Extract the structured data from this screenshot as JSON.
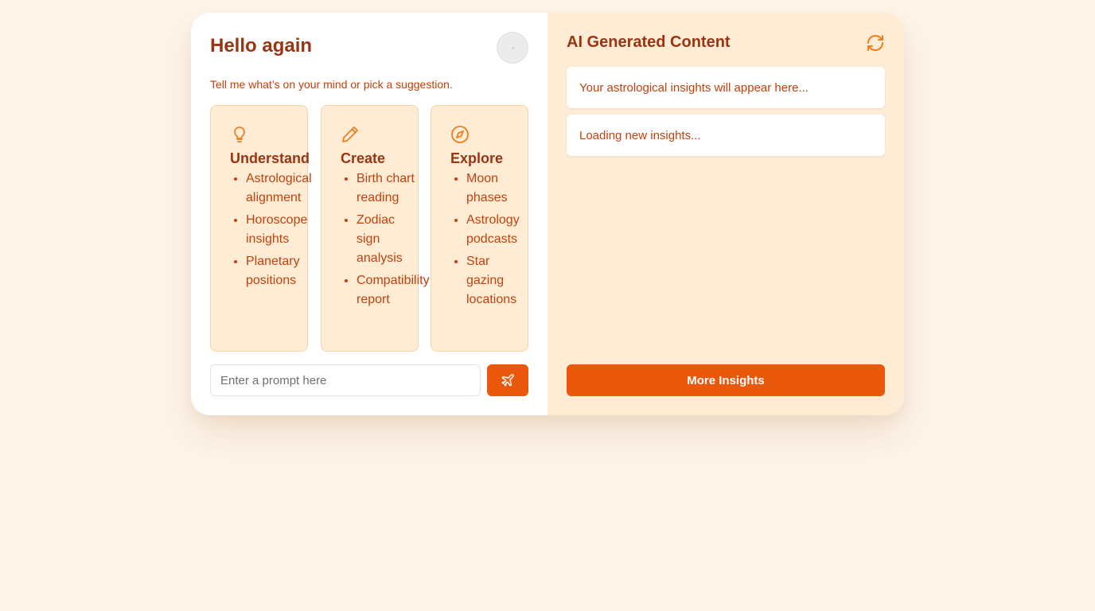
{
  "left": {
    "greeting": "Hello again",
    "subtitle": "Tell me what’s on your mind or pick a suggestion.",
    "suggestions": [
      {
        "icon": "lightbulb-icon",
        "title": "Understand",
        "items": [
          "Astrological alignment",
          "Horoscope insights",
          "Planetary positions"
        ]
      },
      {
        "icon": "pencil-icon",
        "title": "Create",
        "items": [
          "Birth chart reading",
          "Zodiac sign analysis",
          "Compatibility report"
        ]
      },
      {
        "icon": "compass-icon",
        "title": "Explore",
        "items": [
          "Moon phases",
          "Astrology podcasts",
          "Star gazing locations"
        ]
      }
    ],
    "prompt_placeholder": "Enter a prompt here",
    "send_icon": "plane-icon"
  },
  "right": {
    "title": "AI Generated Content",
    "refresh_icon": "refresh-icon",
    "insights": [
      "Your astrological insights will appear here...",
      "Loading new insights..."
    ],
    "more_button": "More Insights"
  },
  "colors": {
    "accent": "#ea580c",
    "heading": "#9a3412",
    "text": "#c2410c",
    "panel": "#feecd5",
    "page_bg": "#fef5eb"
  }
}
